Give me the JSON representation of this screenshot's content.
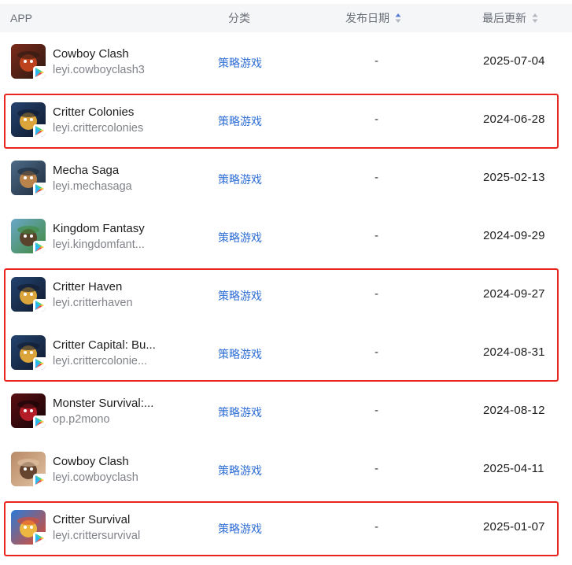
{
  "header": {
    "app": "APP",
    "category": "分类",
    "publish_date": "发布日期",
    "last_update": "最后更新"
  },
  "rows": [
    {
      "name": "Cowboy Clash",
      "package": "leyi.cowboyclash3",
      "category": "策略游戏",
      "publish": "-",
      "updated": "2025-07-04",
      "icon": "cowboy-game-icon",
      "colors": [
        "#7a2a1a",
        "#c9461f",
        "#2e1a12"
      ]
    },
    {
      "name": "Critter Colonies",
      "package": "leyi.crittercolonies",
      "category": "策略游戏",
      "publish": "-",
      "updated": "2024-06-28",
      "icon": "duck-game-icon",
      "colors": [
        "#23436e",
        "#f2b23a",
        "#101a2e"
      ]
    },
    {
      "name": "Mecha Saga",
      "package": "leyi.mechasaga",
      "category": "策略游戏",
      "publish": "-",
      "updated": "2025-02-13",
      "icon": "mecha-game-icon",
      "colors": [
        "#4d6a88",
        "#c98a4a",
        "#1e2c3c"
      ]
    },
    {
      "name": "Kingdom Fantasy",
      "package": "leyi.kingdomfant...",
      "category": "策略游戏",
      "publish": "-",
      "updated": "2024-09-29",
      "icon": "kingdom-game-icon",
      "colors": [
        "#6aa7c9",
        "#5a3a22",
        "#3f8a3a"
      ]
    },
    {
      "name": "Critter Haven",
      "package": "leyi.critterhaven",
      "category": "策略游戏",
      "publish": "-",
      "updated": "2024-09-27",
      "icon": "duck-game-icon",
      "colors": [
        "#23436e",
        "#f2b23a",
        "#101a2e"
      ]
    },
    {
      "name": "Critter Capital: Bu...",
      "package": "leyi.crittercolonie...",
      "category": "策略游戏",
      "publish": "-",
      "updated": "2024-08-31",
      "icon": "duck-game-icon",
      "colors": [
        "#23436e",
        "#f2b23a",
        "#101a2e"
      ]
    },
    {
      "name": "Monster Survival:...",
      "package": "op.p2mono",
      "category": "策略游戏",
      "publish": "-",
      "updated": "2024-08-12",
      "icon": "monster-game-icon",
      "colors": [
        "#5a0e12",
        "#c2202a",
        "#150406"
      ]
    },
    {
      "name": "Cowboy Clash",
      "package": "leyi.cowboyclash",
      "category": "策略游戏",
      "publish": "-",
      "updated": "2025-04-11",
      "icon": "cowboy-game-icon",
      "colors": [
        "#b98a66",
        "#5a3a26",
        "#e0c2a4"
      ]
    },
    {
      "name": "Critter Survival",
      "package": "leyi.crittersurvival",
      "category": "策略游戏",
      "publish": "-",
      "updated": "2025-01-07",
      "icon": "duck-game-icon",
      "colors": [
        "#2a7ad8",
        "#f6c13a",
        "#e24a2a"
      ]
    }
  ],
  "highlighted_rows": [
    [
      1
    ],
    [
      4,
      5
    ],
    [
      8
    ]
  ],
  "colors": {
    "highlight": "#e8261f",
    "category_link": "#2f6fd6",
    "play_badge": [
      "#2bb7f0",
      "#39d47a",
      "#f7c636",
      "#f0473d"
    ]
  }
}
